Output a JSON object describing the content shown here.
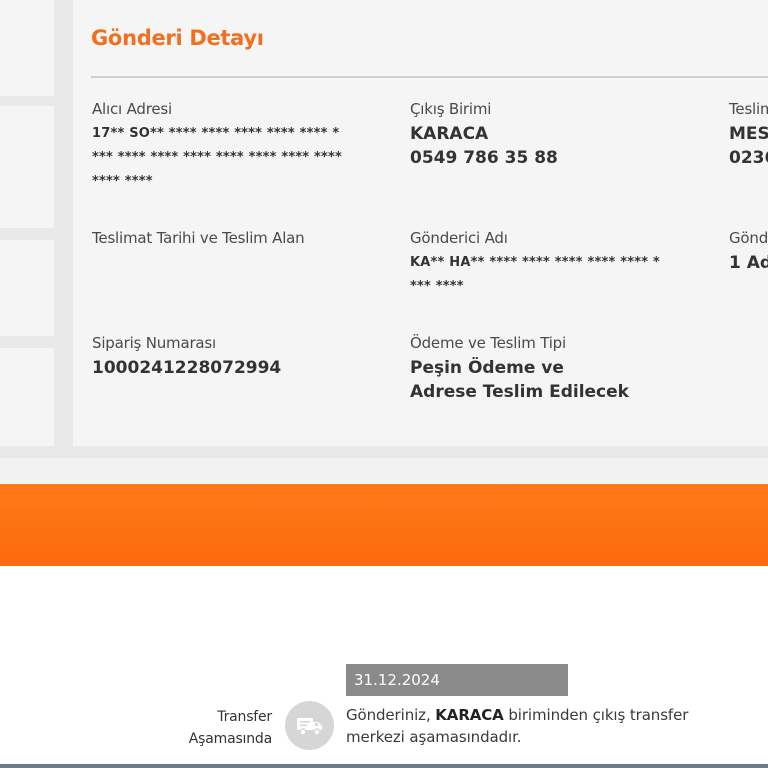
{
  "detail": {
    "title": "Gönderi Detayı",
    "fields": {
      "recipient_address": {
        "label": "Alıcı Adresi",
        "line1": "17** SO** **** **** **** **** **** *",
        "line2": "*** **** **** **** **** **** **** ****",
        "line3": "**** ****"
      },
      "exit_unit": {
        "label": "Çıkış Birimi",
        "line1": "KARACA",
        "line2": "0549 786 35 88"
      },
      "delivery_unit": {
        "label": "Teslim",
        "line1": "MES",
        "line2": "0236"
      },
      "delivery_date": {
        "label": "Teslimat Tarihi ve Teslim Alan"
      },
      "sender_name": {
        "label": "Gönderici Adı",
        "line1": "KA** HA** **** **** **** **** **** *",
        "line2": "*** ****"
      },
      "sender_count": {
        "label": "Gönd",
        "line1": "1 Ad"
      },
      "order_number": {
        "label": "Sipariş Numarası",
        "value": "1000241228072994"
      },
      "payment_type": {
        "label": "Ödeme ve Teslim Tipi",
        "line1": "Peşin Ödeme ve",
        "line2": "Adrese Teslim Edilecek"
      }
    }
  },
  "timeline": {
    "step": {
      "label_line1": "Transfer",
      "label_line2": "Aşamasında",
      "icon": "delivery-truck-icon",
      "date": "31.12.2024",
      "desc_prefix": "Gönderiniz, ",
      "desc_unit": "KARACA",
      "desc_suffix": " biriminden çıkış transfer merkezi aşamasındadır."
    }
  },
  "colors": {
    "accent": "#f36f20",
    "banner": "#fb6a0c",
    "date_badge": "#8a8a8a",
    "icon_circle": "#d6d6d6"
  }
}
